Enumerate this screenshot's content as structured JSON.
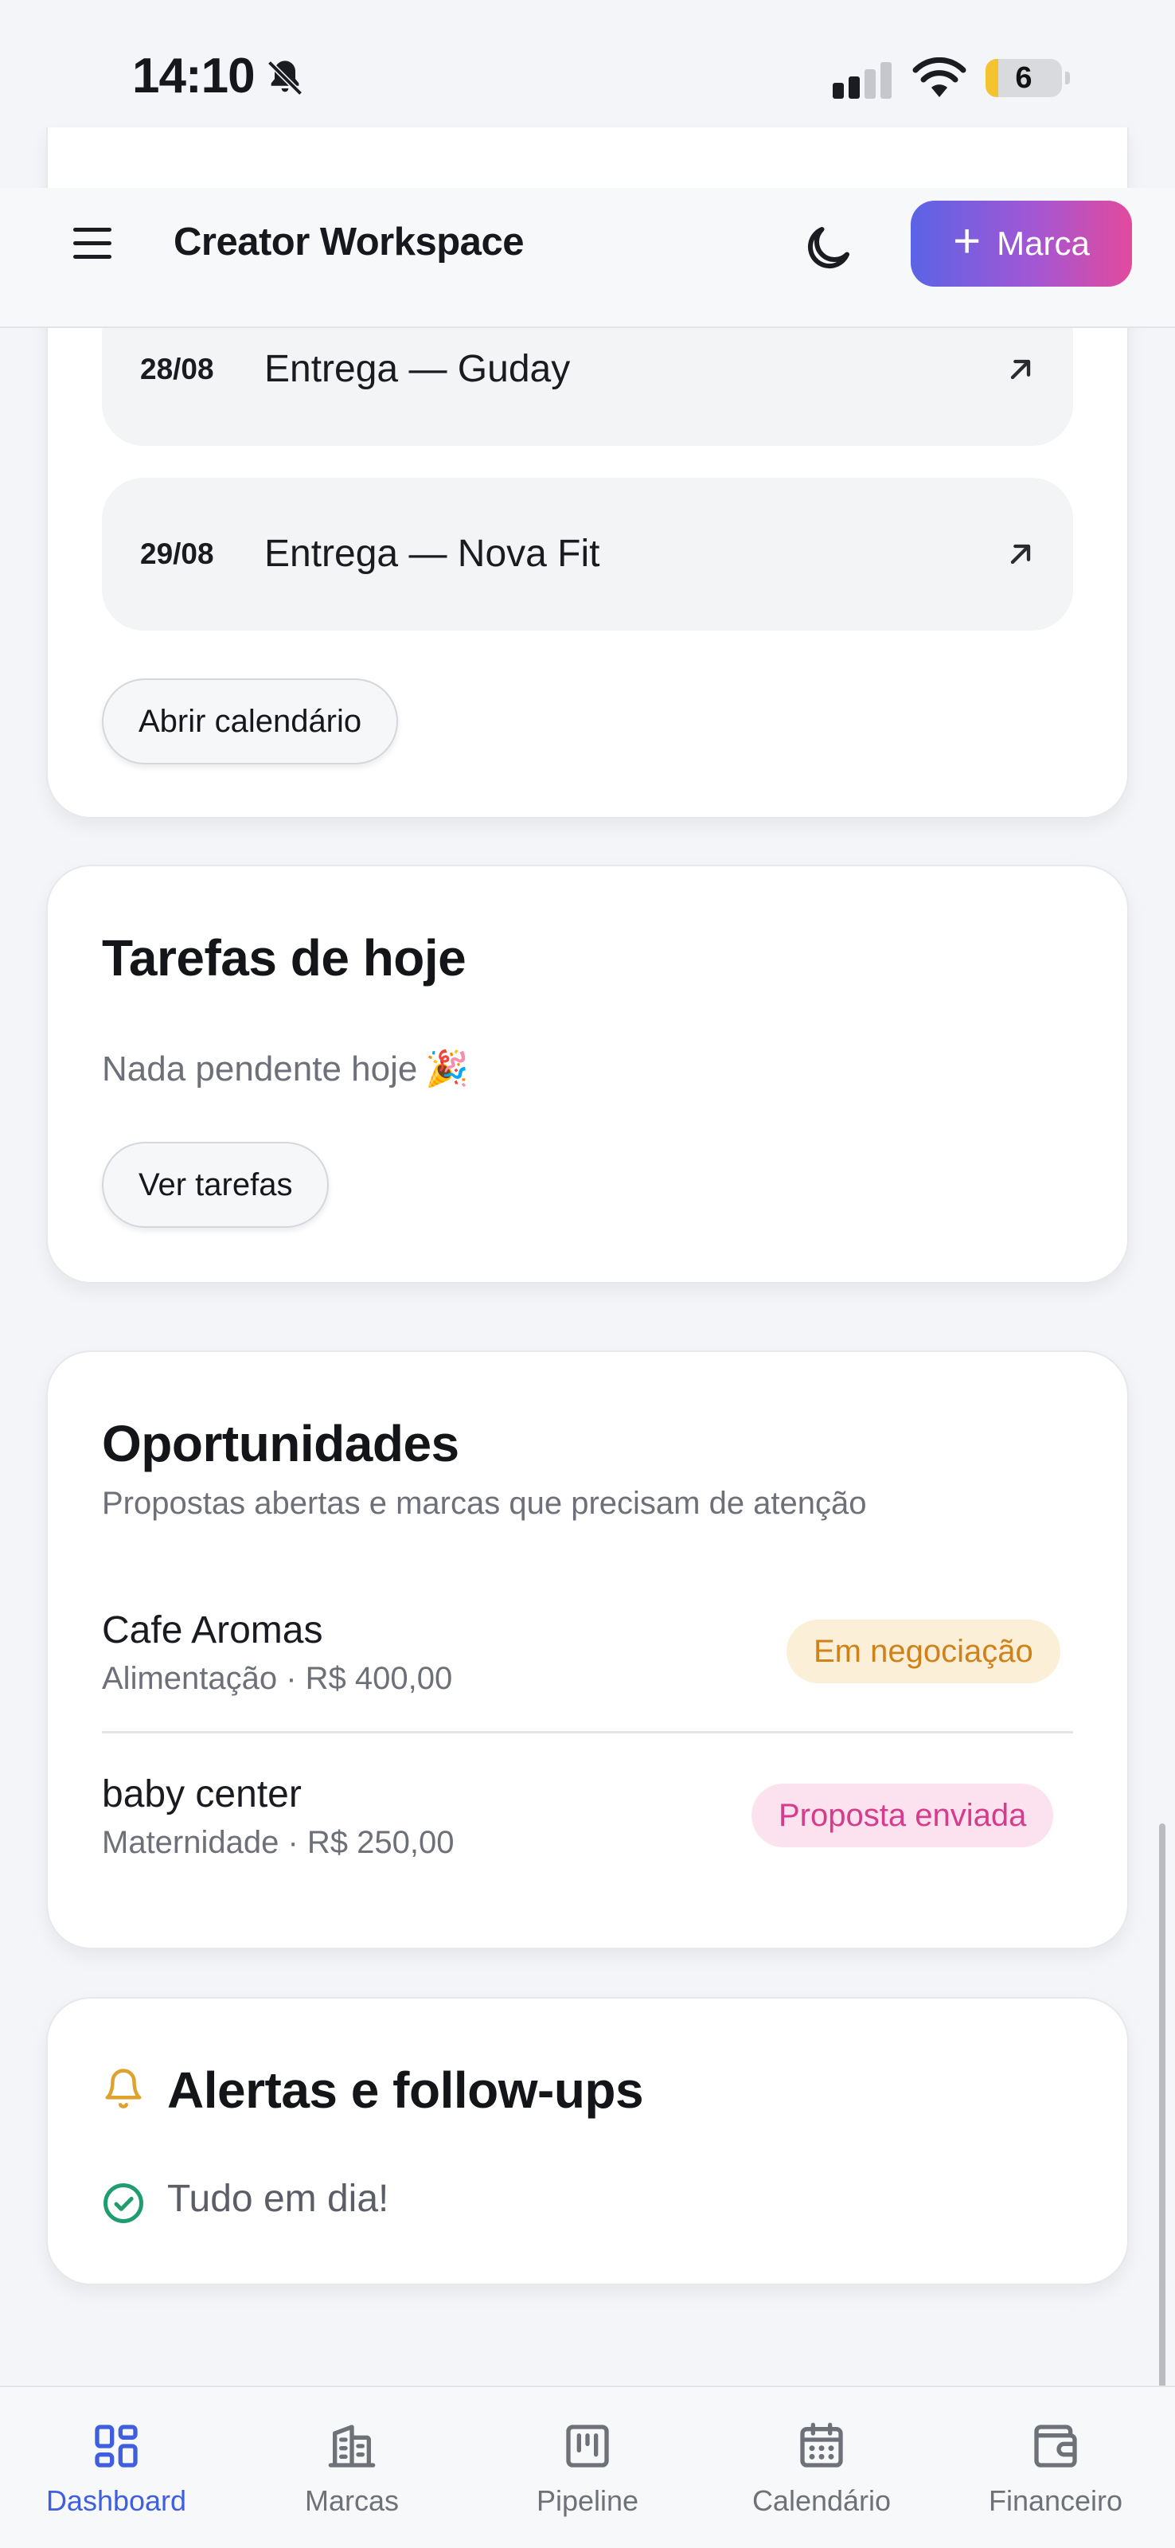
{
  "status_bar": {
    "time": "14:10",
    "battery": "6"
  },
  "header": {
    "title": "Creator Workspace",
    "new_brand_label": "Marca"
  },
  "calendar": {
    "events": [
      {
        "date": "28/08",
        "title": "Entrega — Guday"
      },
      {
        "date": "29/08",
        "title": "Entrega — Nova Fit"
      }
    ],
    "open_label": "Abrir calendário"
  },
  "tasks": {
    "title": "Tarefas de hoje",
    "empty_text": "Nada pendente hoje",
    "empty_emoji": "🎉",
    "view_label": "Ver tarefas"
  },
  "opportunities": {
    "title": "Oportunidades",
    "subtitle": "Propostas abertas e marcas que precisam de atenção",
    "items": [
      {
        "name": "Cafe Aromas",
        "meta": "Alimentação · R$ 400,00",
        "status": "Em negociação",
        "status_color": "#d0821a"
      },
      {
        "name": "baby center",
        "meta": "Maternidade · R$ 250,00",
        "status": "Proposta enviada",
        "status_color": "#d63b8c"
      }
    ]
  },
  "alerts": {
    "title": "Alertas e follow-ups",
    "ok_text": "Tudo em dia!"
  },
  "bottom_nav": {
    "active": "Dashboard",
    "items": [
      {
        "label": "Dashboard",
        "icon": "dashboard-icon"
      },
      {
        "label": "Marcas",
        "icon": "building-icon"
      },
      {
        "label": "Pipeline",
        "icon": "kanban-icon"
      },
      {
        "label": "Calendário",
        "icon": "calendar-icon"
      },
      {
        "label": "Financeiro",
        "icon": "wallet-icon"
      }
    ]
  },
  "colors": {
    "accent": "#3f5fe0",
    "gradient_start": "#5b63e6",
    "gradient_end": "#e24a9c",
    "success": "#1f9d6e",
    "warning": "#e0a22f"
  }
}
